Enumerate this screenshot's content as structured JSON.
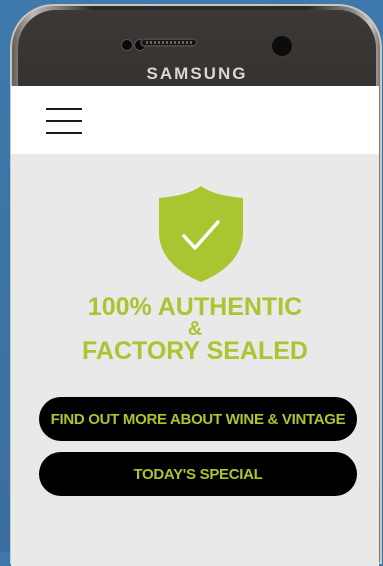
{
  "device": {
    "brand": "SAMSUNG"
  },
  "app": {
    "menu_icon": "hamburger-menu-icon",
    "badge_icon": "shield-check-icon",
    "headline": {
      "line1": "100% AUTHENTIC",
      "line2": "&",
      "line3": "FACTORY SEALED"
    },
    "buttons": {
      "find_out_more": "FIND OUT MORE ABOUT WINE & VINTAGE",
      "todays_special": "TODAY'S SPECIAL"
    }
  },
  "colors": {
    "accent": "#a9c52f",
    "button_bg": "#000000",
    "screen_bg": "#e9e9ea"
  }
}
